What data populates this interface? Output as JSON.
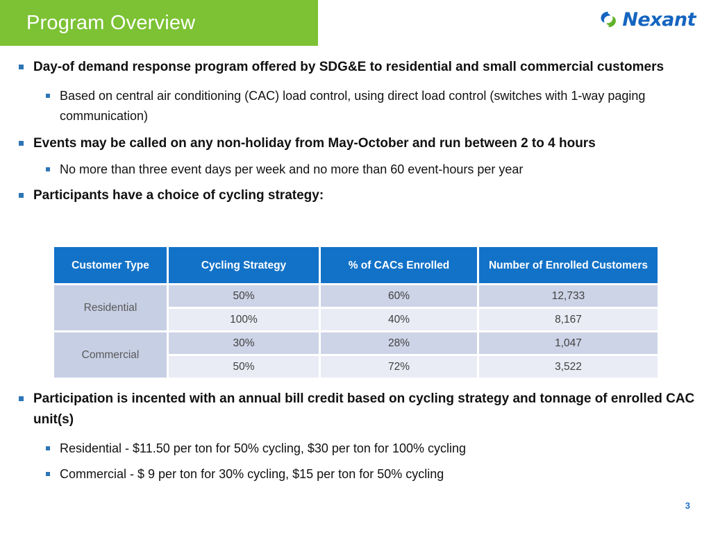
{
  "slide": {
    "title": "Program Overview",
    "page_number": "3",
    "accent_green": "#7CC234",
    "accent_blue": "#1272C8",
    "bullet_color": "#2E75B6"
  },
  "logo": {
    "wordmark": "Nexant",
    "mark_name": "nexant-swirl-icon",
    "blue": "#1565C0",
    "green": "#5FB12A"
  },
  "bullets": [
    {
      "level": 1,
      "text": "Day-of demand response program offered by SDG&E to residential and small commercial customers"
    },
    {
      "level": 2,
      "text": "Based on central air conditioning (CAC) load control, using direct load control (switches with 1-way paging communication)"
    },
    {
      "level": 1,
      "text": "Events may be called on any non-holiday from May-October and run between 2 to 4 hours"
    },
    {
      "level": 2,
      "text": "No more than three event days per week and no more than 60 event-hours per year"
    },
    {
      "level": 1,
      "text": "Participants have a choice of cycling strategy:"
    }
  ],
  "bullets_after_table": [
    {
      "level": 1,
      "text": "Participation is incented with an annual bill credit based on cycling strategy and tonnage of enrolled CAC unit(s)"
    },
    {
      "level": 2,
      "text": "Residential - $11.50 per ton for 50% cycling, $30 per ton for 100% cycling"
    },
    {
      "level": 2,
      "text": "Commercial - $ 9 per ton for 30% cycling, $15 per ton for 50% cycling"
    }
  ],
  "table": {
    "headers": [
      "Customer Type",
      "Cycling Strategy",
      "% of CACs Enrolled",
      "Number of Enrolled Customers"
    ],
    "groups": [
      {
        "label": "Residential",
        "rows": [
          {
            "strategy": "50%",
            "pct": "60%",
            "customers": "12,733"
          },
          {
            "strategy": "100%",
            "pct": "40%",
            "customers": "8,167"
          }
        ]
      },
      {
        "label": "Commercial",
        "rows": [
          {
            "strategy": "30%",
            "pct": "28%",
            "customers": "1,047"
          },
          {
            "strategy": "50%",
            "pct": "72%",
            "customers": "3,522"
          }
        ]
      }
    ]
  }
}
